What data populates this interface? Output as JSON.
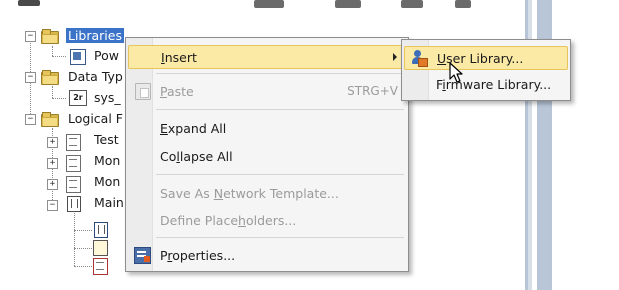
{
  "tree": {
    "nodes": [
      {
        "label": "Libraries",
        "selected": true
      },
      {
        "label": "Pow"
      },
      {
        "label": "Data Typ"
      },
      {
        "label": "sys_"
      },
      {
        "label": "Logical F"
      },
      {
        "label": "Test"
      },
      {
        "label": "Mon"
      },
      {
        "label": "Mon"
      },
      {
        "label": "Main"
      }
    ]
  },
  "context_menu": {
    "items": [
      {
        "label_pre": "",
        "label_u": "I",
        "label_post": "nsert",
        "has_submenu": true,
        "hover": true
      },
      {
        "label_pre": "",
        "label_u": "P",
        "label_post": "aste",
        "shortcut": "STRG+V",
        "disabled": true
      },
      {
        "label_pre": "",
        "label_u": "E",
        "label_post": "xpand All"
      },
      {
        "label_pre": "Co",
        "label_u": "l",
        "label_post": "lapse All"
      },
      {
        "label_pre": "Save As ",
        "label_u": "N",
        "label_post": "etwork Template...",
        "disabled": true
      },
      {
        "label_pre": "Define Place",
        "label_u": "h",
        "label_post": "olders...",
        "disabled": true
      },
      {
        "label_pre": "P",
        "label_u": "r",
        "label_post": "operties..."
      }
    ]
  },
  "submenu": {
    "items": [
      {
        "label_pre": "",
        "label_u": "U",
        "label_post": "ser Library...",
        "hover": true
      },
      {
        "label_pre": "F",
        "label_u": "i",
        "label_post": "rmware Library..."
      }
    ]
  },
  "colors": {
    "selection": "#3b73c8",
    "menu_hover": "#fbe9a6",
    "menu_hover_border": "#e7c55a",
    "folder": "#d9b84a",
    "disabled_text": "#9b9b9b"
  }
}
